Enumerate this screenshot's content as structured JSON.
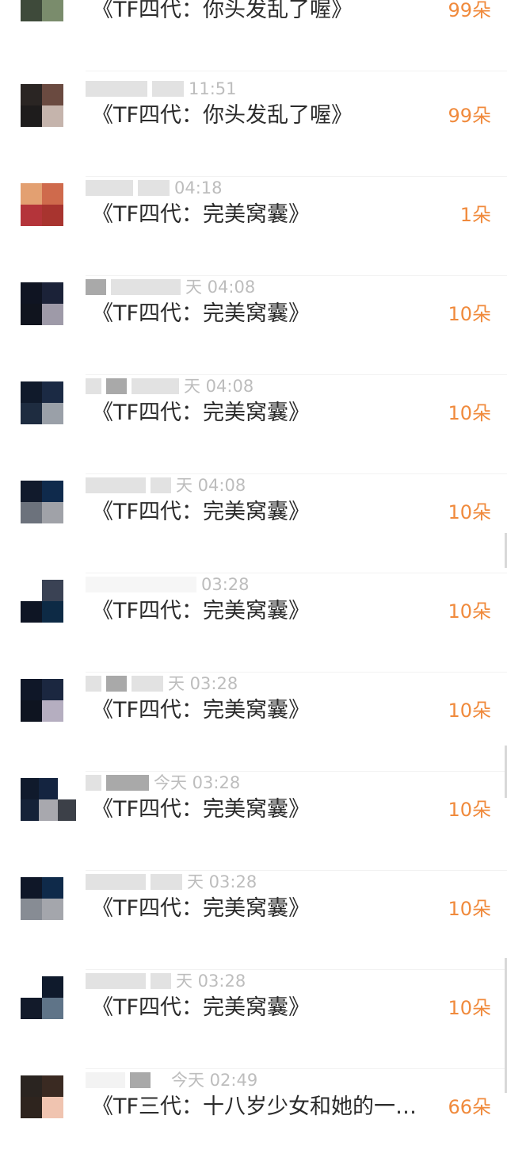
{
  "items": [
    {
      "meta": "",
      "title": "《TF四代：你头发乱了喔》",
      "count": "99朵"
    },
    {
      "meta": "11:51",
      "title": "《TF四代：你头发乱了喔》",
      "count": "99朵"
    },
    {
      "meta": "04:18",
      "title": "《TF四代：完美窝囊》",
      "count": "1朵"
    },
    {
      "meta": "天 04:08",
      "title": "《TF四代：完美窝囊》",
      "count": "10朵"
    },
    {
      "meta": "天 04:08",
      "title": "《TF四代：完美窝囊》",
      "count": "10朵"
    },
    {
      "meta": "天 04:08",
      "title": "《TF四代：完美窝囊》",
      "count": "10朵"
    },
    {
      "meta": "03:28",
      "title": "《TF四代：完美窝囊》",
      "count": "10朵"
    },
    {
      "meta": "天 03:28",
      "title": "《TF四代：完美窝囊》",
      "count": "10朵"
    },
    {
      "meta": "今天 03:28",
      "title": "《TF四代：完美窝囊》",
      "count": "10朵"
    },
    {
      "meta": "天 03:28",
      "title": "《TF四代：完美窝囊》",
      "count": "10朵"
    },
    {
      "meta": "天 03:28",
      "title": "《TF四代：完美窝囊》",
      "count": "10朵"
    },
    {
      "meta": "今天 02:49",
      "title": "《TF三代：十八岁少女和她的一…",
      "count": "66朵"
    }
  ],
  "colors": {
    "accent": "#f08a3c",
    "text": "#2b2b2b",
    "meta": "#bdbdbd"
  }
}
